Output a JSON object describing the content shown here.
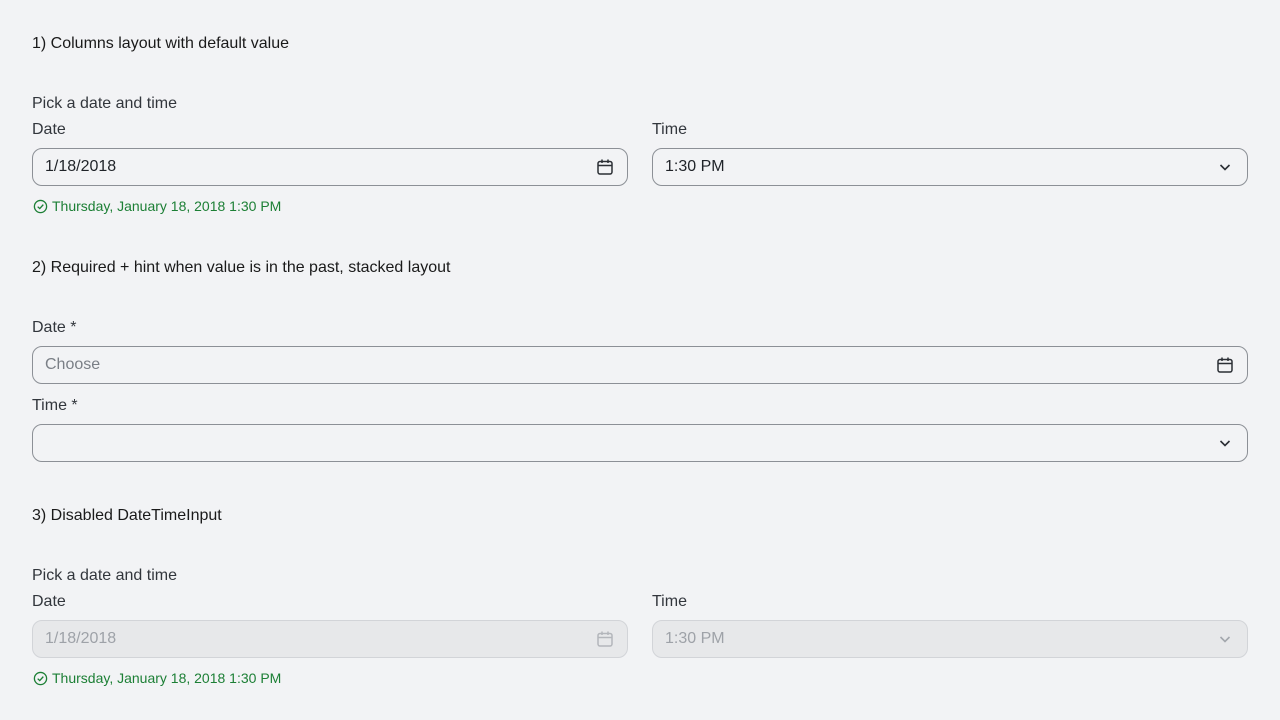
{
  "sections": [
    {
      "title": "1) Columns layout with default value",
      "group_label": "Pick a date and time",
      "date": {
        "label": "Date",
        "value": "1/18/2018"
      },
      "time": {
        "label": "Time",
        "value": "1:30 PM"
      },
      "hint": "Thursday, January 18, 2018 1:30 PM"
    },
    {
      "title": "2) Required + hint when value is in the past, stacked layout",
      "date": {
        "label": "Date *",
        "placeholder": "Choose",
        "value": ""
      },
      "time": {
        "label": "Time *",
        "value": ""
      }
    },
    {
      "title": "3) Disabled DateTimeInput",
      "group_label": "Pick a date and time",
      "date": {
        "label": "Date",
        "value": "1/18/2018"
      },
      "time": {
        "label": "Time",
        "value": "1:30 PM"
      },
      "hint": "Thursday, January 18, 2018 1:30 PM"
    }
  ],
  "colors": {
    "background": "#f2f3f5",
    "border": "#8c9096",
    "success": "#1c7f35",
    "disabled_bg": "#e7e8ea"
  },
  "icons": {
    "calendar": "calendar-icon",
    "chevron": "chevron-down-icon",
    "check": "check-circle-icon"
  }
}
